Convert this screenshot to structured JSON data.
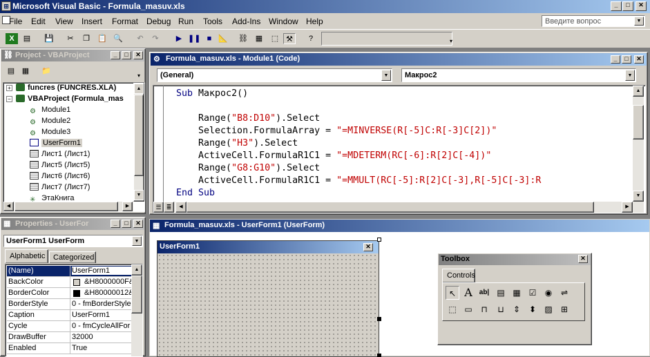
{
  "app": {
    "title": "Microsoft Visual Basic - Formula_masuv.xls"
  },
  "menu": [
    "File",
    "Edit",
    "View",
    "Insert",
    "Format",
    "Debug",
    "Run",
    "Tools",
    "Add-Ins",
    "Window",
    "Help"
  ],
  "help_box": {
    "placeholder": "Введите вопрос"
  },
  "project": {
    "title": "Project - VBAProject",
    "tree": [
      {
        "label": "funcres (FUNCRES.XLA)",
        "bold": true
      },
      {
        "label": "VBAProject (Formula_mas",
        "bold": true
      },
      {
        "label": "Module1"
      },
      {
        "label": "Module2"
      },
      {
        "label": "Module3"
      },
      {
        "label": "UserForm1"
      },
      {
        "label": "Лист1 (Лист1)"
      },
      {
        "label": "Лист5 (Лист5)"
      },
      {
        "label": "Лист6 (Лист6)"
      },
      {
        "label": "Лист7 (Лист7)"
      },
      {
        "label": "ЭтаКнига"
      }
    ]
  },
  "code_window": {
    "title": "Formula_masuv.xls - Module1 (Code)",
    "object_combo": "(General)",
    "proc_combo": "Макрос2",
    "lines": [
      {
        "kw": "Sub ",
        "plain": "Макрос2()",
        "str": ""
      },
      {
        "kw": "",
        "plain": "",
        "str": ""
      },
      {
        "kw": "",
        "plain": "    Range(",
        "str": "\"B8:D10\"",
        "tail": ").Select"
      },
      {
        "kw": "",
        "plain": "    Selection.FormulaArray = ",
        "str": "\"=MINVERSE(R[-5]C:R[-3]C[2])\""
      },
      {
        "kw": "",
        "plain": "    Range(",
        "str": "\"H3\"",
        "tail": ").Select"
      },
      {
        "kw": "",
        "plain": "    ActiveCell.FormulaR1C1 = ",
        "str": "\"=MDETERM(RC[-6]:R[2]C[-4])\""
      },
      {
        "kw": "",
        "plain": "    Range(",
        "str": "\"G8:G10\"",
        "tail": ").Select"
      },
      {
        "kw": "",
        "plain": "    ActiveCell.FormulaR1C1 = ",
        "str": "\"=MMULT(RC[-5]:R[2]C[-3],R[-5]C[-3]:R"
      },
      {
        "kw": "End Sub",
        "plain": "",
        "str": ""
      }
    ]
  },
  "properties": {
    "title": "Properties - UserFor",
    "object": "UserForm1 UserForm",
    "tabs": [
      "Alphabetic",
      "Categorized"
    ],
    "rows": [
      {
        "name": "(Name)",
        "value": "UserForm1"
      },
      {
        "name": "BackColor",
        "value": "&H8000000F&"
      },
      {
        "name": "BorderColor",
        "value": "&H80000012&"
      },
      {
        "name": "BorderStyle",
        "value": "0 - fmBorderStyle"
      },
      {
        "name": "Caption",
        "value": "UserForm1"
      },
      {
        "name": "Cycle",
        "value": "0 - fmCycleAllFor"
      },
      {
        "name": "DrawBuffer",
        "value": "32000"
      },
      {
        "name": "Enabled",
        "value": "True"
      }
    ]
  },
  "form_window": {
    "title": "Formula_masuv.xls - UserForm1 (UserForm)",
    "form_caption": "UserForm1"
  },
  "toolbox": {
    "title": "Toolbox",
    "tab": "Controls"
  },
  "colors": {
    "titlebar": "#0a246a",
    "face": "#d4d0c8",
    "keyword": "#000080",
    "string": "#c00000"
  }
}
